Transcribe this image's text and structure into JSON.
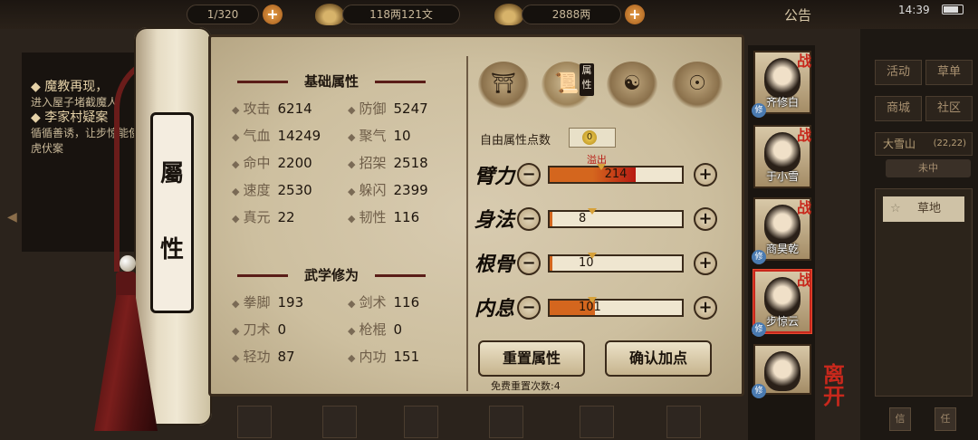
{
  "topbar": {
    "capacity": "1/320",
    "silver": "118两121文",
    "gold": "2888两",
    "announce": "公告",
    "time": "14:39"
  },
  "quests": {
    "q1_title": "魔教再现，",
    "q1_desc": "进入屋子堵截魔人",
    "q2_title": "李家村疑案",
    "q2_desc": "循循善诱，让步惊能使出猛虎伏案"
  },
  "side_menu": {
    "activity": "活动",
    "herb": "草单",
    "shop": "商城",
    "community": "社区",
    "region": "大雪山",
    "region_time": "(22,22)",
    "weiz": "未中",
    "terrain": "草地",
    "btn_a": "信",
    "btn_b": "任"
  },
  "scroll": {
    "char1": "屬",
    "char2": "性"
  },
  "basic": {
    "title": "基础属性",
    "stats": [
      {
        "label": "攻击",
        "value": "6214"
      },
      {
        "label": "防御",
        "value": "5247"
      },
      {
        "label": "气血",
        "value": "14249"
      },
      {
        "label": "聚气",
        "value": "10"
      },
      {
        "label": "命中",
        "value": "2200"
      },
      {
        "label": "招架",
        "value": "2518"
      },
      {
        "label": "速度",
        "value": "2530"
      },
      {
        "label": "躲闪",
        "value": "2399"
      },
      {
        "label": "真元",
        "value": "22"
      },
      {
        "label": "韧性",
        "value": "116"
      }
    ]
  },
  "martial": {
    "title": "武学修为",
    "stats": [
      {
        "label": "拳脚",
        "value": "193"
      },
      {
        "label": "剑术",
        "value": "116"
      },
      {
        "label": "刀术",
        "value": "0"
      },
      {
        "label": "枪棍",
        "value": "0"
      },
      {
        "label": "轻功",
        "value": "87"
      },
      {
        "label": "内功",
        "value": "151"
      }
    ]
  },
  "alloc": {
    "tab_badge": "属性",
    "free_points_label": "自由属性点数",
    "free_points": "0",
    "overflow": "溢出",
    "attrs": [
      {
        "name": "臂力",
        "value": "214",
        "fill": 0.65
      },
      {
        "name": "身法",
        "value": "8",
        "fill": 0.02
      },
      {
        "name": "根骨",
        "value": "10",
        "fill": 0.02
      },
      {
        "name": "内息",
        "value": "101",
        "fill": 0.34
      }
    ],
    "minus": "−",
    "plus": "+",
    "reset_btn": "重置属性",
    "confirm_btn": "确认加点",
    "reset_count": "免费重置次数:4"
  },
  "characters": [
    {
      "name": "齐修白",
      "battle": "战",
      "cultivation": "修"
    },
    {
      "name": "于小雪",
      "battle": "战",
      "cultivation": ""
    },
    {
      "name": "商昊乾",
      "battle": "战",
      "cultivation": "修"
    },
    {
      "name": "步惊云",
      "battle": "战",
      "cultivation": "修"
    },
    {
      "name": "",
      "battle": "",
      "cultivation": "修"
    }
  ],
  "leave": "离开",
  "colors": {
    "accent_red": "#c8281c",
    "bar_fill": "#d4661e",
    "bar_overflow": "#b81a12"
  }
}
